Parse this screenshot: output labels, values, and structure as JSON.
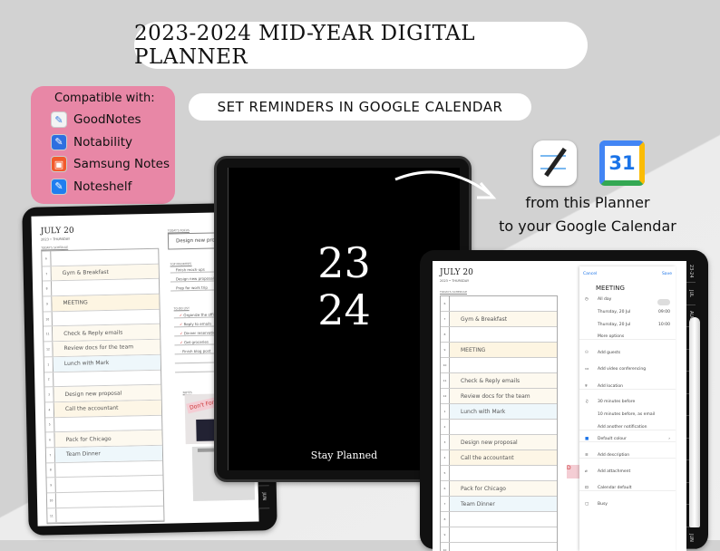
{
  "title": "2023-2024 MID-YEAR DIGITAL PLANNER",
  "subtitle": "SET REMINDERS IN GOOGLE CALENDAR",
  "compat": {
    "heading": "Compatible with:",
    "apps": [
      {
        "name": "GoodNotes",
        "icon": "goodnotes-icon",
        "color": "#f3f3f3"
      },
      {
        "name": "Notability",
        "icon": "notability-icon",
        "color": "#2e6fe0"
      },
      {
        "name": "Samsung Notes",
        "icon": "samsung-notes-icon",
        "color": "#f25a2c"
      },
      {
        "name": "Noteshelf",
        "icon": "noteshelf-icon",
        "color": "#1f7ef0"
      }
    ]
  },
  "cover": {
    "y1": "23",
    "y2": "24",
    "tagline": "Stay Planned"
  },
  "promo": {
    "line1": "from this Planner",
    "line2": "to your Google Calendar"
  },
  "planner": {
    "date": "JULY 20",
    "sub": "2023 • THURSDAY",
    "schedule_label": "TODAY'S SCHEDULE",
    "focus_label": "TODAY'S FOCUS",
    "focus": "Design new proposal",
    "priorities_label": "TOP PRIORITIES",
    "priorities": [
      "Finish mock-ups",
      "Design new proposal",
      "Prep for work trip"
    ],
    "todo_label": "TO-DO LIST",
    "todos": [
      {
        "t": "Organize the office",
        "done": true
      },
      {
        "t": "Reply to emails",
        "done": true
      },
      {
        "t": "Dinner reservation",
        "done": true
      },
      {
        "t": "Get groceries",
        "done": true
      },
      {
        "t": "Finish blog post",
        "done": false
      }
    ],
    "notes_label": "NOTES",
    "sticker": "Don't Forget",
    "mini_month": "JULY",
    "tabs": [
      "23-24",
      "JUL",
      "AUG",
      "SEP",
      "OCT",
      "NOV",
      "DEC",
      "JAN",
      "FEB",
      "MAR",
      "APR",
      "MAY",
      "JUN"
    ],
    "rows": [
      {
        "h": "6",
        "t": "",
        "c": ""
      },
      {
        "h": "7",
        "t": "Gym & Breakfast",
        "c": "#fdf8ec"
      },
      {
        "h": "8",
        "t": "",
        "c": ""
      },
      {
        "h": "9",
        "t": "MEETING",
        "c": "#fdf5e2"
      },
      {
        "h": "10",
        "t": "",
        "c": ""
      },
      {
        "h": "11",
        "t": "Check & Reply emails",
        "c": "#fdf9ef"
      },
      {
        "h": "12",
        "t": "Review docs for the team",
        "c": "#fdf9ef"
      },
      {
        "h": "1",
        "t": "Lunch with Mark",
        "c": "#eef7fb"
      },
      {
        "h": "2",
        "t": "",
        "c": ""
      },
      {
        "h": "3",
        "t": "Design new proposal",
        "c": "#fdf9ef"
      },
      {
        "h": "4",
        "t": "Call the accountant",
        "c": "#fdf6e6"
      },
      {
        "h": "5",
        "t": "",
        "c": ""
      },
      {
        "h": "6",
        "t": "Pack for Chicago",
        "c": "#fdf9ef"
      },
      {
        "h": "7",
        "t": "Team Dinner",
        "c": "#eef7fb"
      },
      {
        "h": "8",
        "t": "",
        "c": ""
      },
      {
        "h": "9",
        "t": "",
        "c": ""
      },
      {
        "h": "10",
        "t": "",
        "c": ""
      },
      {
        "h": "11",
        "t": "",
        "c": ""
      }
    ]
  },
  "gcal": {
    "cancel": "Cancel",
    "save": "Save",
    "title": "MEETING",
    "items": [
      {
        "icon": "clock-icon",
        "t": "All day"
      },
      {
        "icon": "",
        "t": "Thursday, 20 Jul",
        "r": "09:00"
      },
      {
        "icon": "",
        "t": "Thursday, 20 Jul",
        "r": "10:00"
      },
      {
        "icon": "",
        "t": "More options"
      },
      {
        "icon": "guests-icon",
        "t": "Add guests"
      },
      {
        "icon": "video-icon",
        "t": "Add video conferencing"
      },
      {
        "icon": "location-icon",
        "t": "Add location"
      },
      {
        "icon": "bell-icon",
        "t": "30 minutes before"
      },
      {
        "icon": "",
        "t": "10 minutes before, as email"
      },
      {
        "icon": "",
        "t": "Add another notification"
      },
      {
        "icon": "color-icon",
        "t": "Default colour",
        "r": "›"
      },
      {
        "icon": "description-icon",
        "t": "Add description"
      },
      {
        "icon": "attachment-icon",
        "t": "Add attachment"
      },
      {
        "icon": "lock-icon",
        "t": "Calendar default"
      },
      {
        "icon": "briefcase-icon",
        "t": "Busy"
      }
    ],
    "accent": "#1a73e8"
  }
}
